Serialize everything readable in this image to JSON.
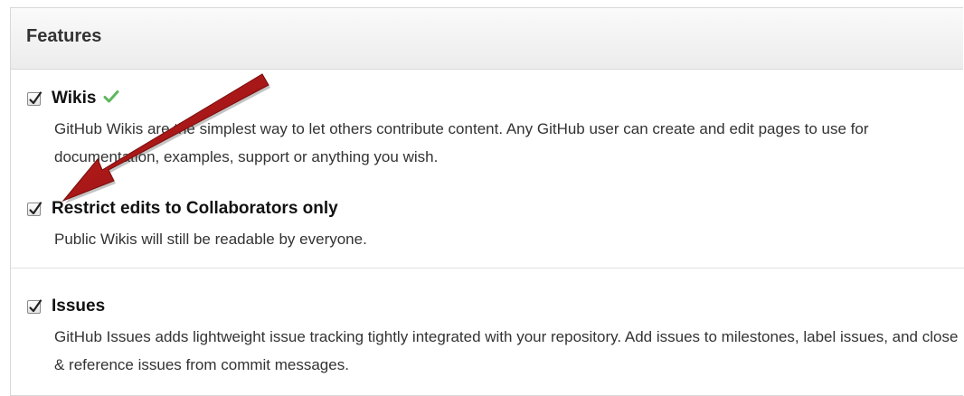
{
  "features": {
    "title": "Features",
    "options": [
      {
        "label": "Wikis",
        "checked": true,
        "enabled_indicator": "green-checkmark-icon",
        "description": "GitHub Wikis are the simplest way to let others contribute content. Any GitHub user can create and edit pages to use for documentation, examples, support or anything you wish."
      },
      {
        "label": "Restrict edits to Collaborators only",
        "checked": true,
        "description": "Public Wikis will still be readable by everyone."
      },
      {
        "label": "Issues",
        "checked": true,
        "description": "GitHub Issues adds lightweight issue tracking tightly integrated with your repository. Add issues to milestones, label issues, and close & reference issues from commit messages."
      }
    ]
  },
  "colors": {
    "annotation_arrow": "#b11a1a",
    "enabled_check": "#5cb85c",
    "header_bg": "#efefef"
  }
}
